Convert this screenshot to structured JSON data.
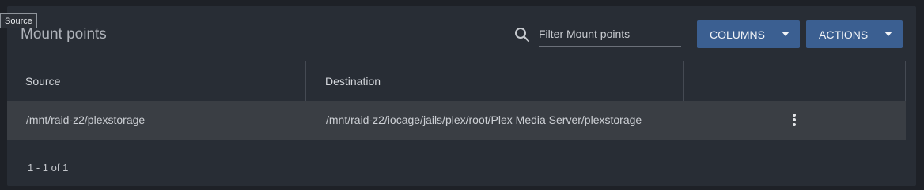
{
  "card": {
    "title": "Mount points"
  },
  "search": {
    "icon": "search-icon",
    "placeholder": "Filter Mount points",
    "value": ""
  },
  "toolbar": {
    "columns_label": "COLUMNS",
    "actions_label": "ACTIONS",
    "accent_color": "#3b5f91"
  },
  "table": {
    "columns": [
      "Source",
      "Destination",
      ""
    ],
    "rows": [
      {
        "source": "/mnt/raid-z2/plexstorage",
        "destination": "/mnt/raid-z2/iocage/jails/plex/root/Plex Media Server/plexstorage",
        "menu_icon": "more-vert-icon"
      }
    ]
  },
  "pagination": {
    "range_text": "1 - 1 of 1"
  },
  "tooltip": {
    "text": "Source"
  }
}
